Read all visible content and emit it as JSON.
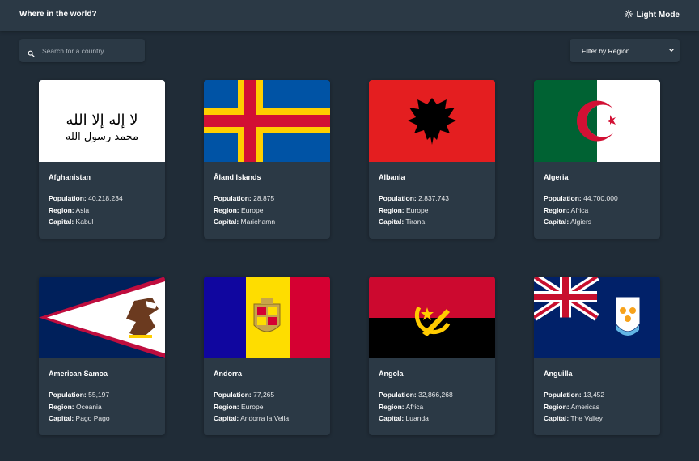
{
  "header": {
    "title": "Where in the world?",
    "theme_label": "Light Mode"
  },
  "search": {
    "placeholder": "Search for a country..."
  },
  "filter": {
    "label": "Filter by Region"
  },
  "labels": {
    "population": "Population:",
    "region": "Region:",
    "capital": "Capital:"
  },
  "countries": [
    {
      "name": "Afghanistan",
      "population": "40,218,234",
      "region": "Asia",
      "capital": "Kabul"
    },
    {
      "name": "Åland Islands",
      "population": "28,875",
      "region": "Europe",
      "capital": "Mariehamn"
    },
    {
      "name": "Albania",
      "population": "2,837,743",
      "region": "Europe",
      "capital": "Tirana"
    },
    {
      "name": "Algeria",
      "population": "44,700,000",
      "region": "Africa",
      "capital": "Algiers"
    },
    {
      "name": "American Samoa",
      "population": "55,197",
      "region": "Oceania",
      "capital": "Pago Pago"
    },
    {
      "name": "Andorra",
      "population": "77,265",
      "region": "Europe",
      "capital": "Andorra la Vella"
    },
    {
      "name": "Angola",
      "population": "32,866,268",
      "region": "Africa",
      "capital": "Luanda"
    },
    {
      "name": "Anguilla",
      "population": "13,452",
      "region": "Americas",
      "capital": "The Valley"
    }
  ],
  "colors": {
    "background": "#202c37",
    "elements": "#2b3945",
    "text": "#ffffff"
  }
}
